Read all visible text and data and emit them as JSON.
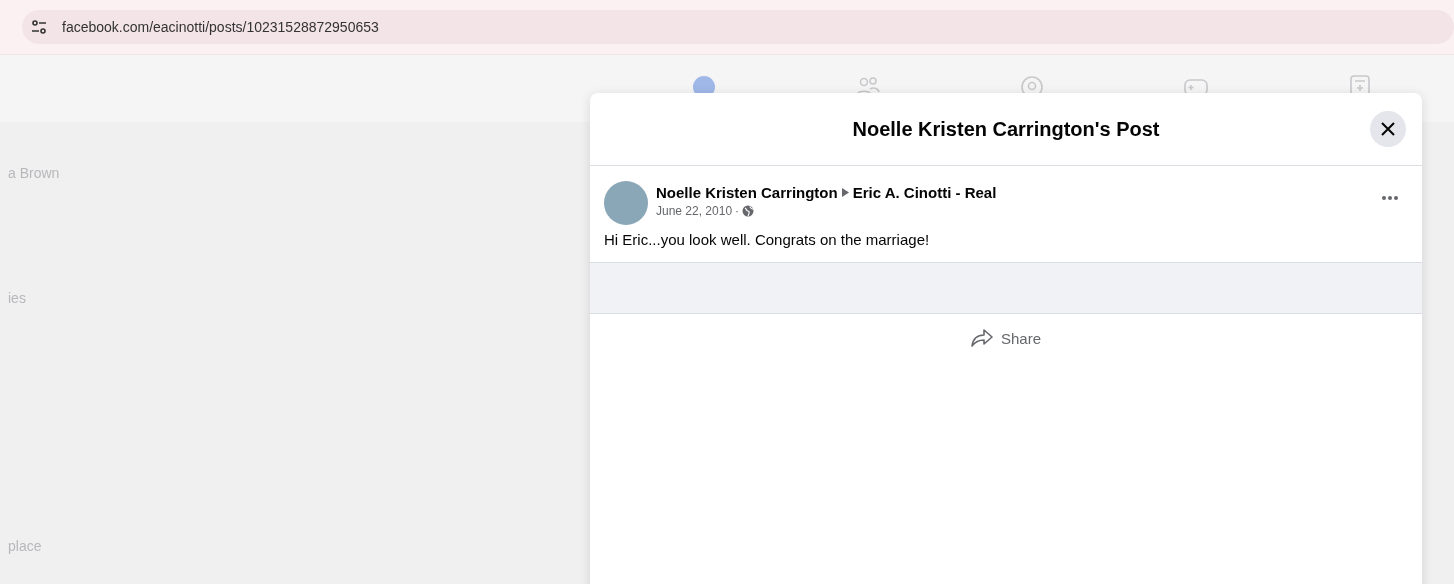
{
  "address_bar": {
    "url": "facebook.com/eacinotti/posts/10231528872950653"
  },
  "sidebar": {
    "items": [
      {
        "label": "a Brown"
      },
      {
        "label": "ies"
      },
      {
        "label": "place"
      }
    ]
  },
  "nav": {
    "items": [
      {
        "kind": "home",
        "selected": true
      },
      {
        "kind": "friends",
        "selected": false
      },
      {
        "kind": "watch",
        "selected": false
      },
      {
        "kind": "gaming",
        "selected": false
      },
      {
        "kind": "feeds",
        "selected": false
      }
    ]
  },
  "dialog": {
    "title": "Noelle Kristen Carrington's Post",
    "post": {
      "author": "Noelle Kristen Carrington",
      "target": "Eric A. Cinotti - Real",
      "date": "June 22, 2010",
      "separator": "·",
      "text": "Hi Eric...you look well. Congrats on the marriage!"
    },
    "actions": [
      {
        "label": "Share"
      }
    ]
  }
}
